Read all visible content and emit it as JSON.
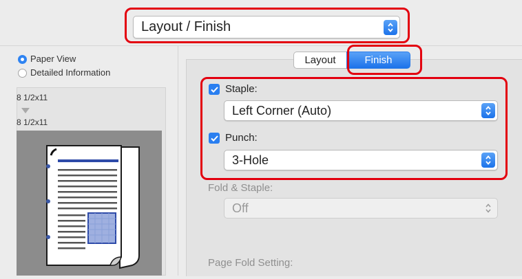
{
  "top_menu": {
    "selected": "Layout / Finish"
  },
  "left": {
    "radio_paper_view": "Paper View",
    "radio_detailed": "Detailed Information",
    "size_top": "8 1/2x11",
    "size_bottom": "8 1/2x11"
  },
  "tabs": {
    "layout": "Layout",
    "finish": "Finish"
  },
  "staple": {
    "label": "Staple:",
    "value": "Left Corner (Auto)",
    "checked": true
  },
  "punch": {
    "label": "Punch:",
    "value": "3-Hole",
    "checked": true
  },
  "fold_staple": {
    "label": "Fold & Staple:",
    "value": "Off"
  },
  "page_fold": {
    "label": "Page Fold Setting:"
  },
  "colors": {
    "accent": "#1c73ea",
    "highlight": "#e3000f"
  }
}
